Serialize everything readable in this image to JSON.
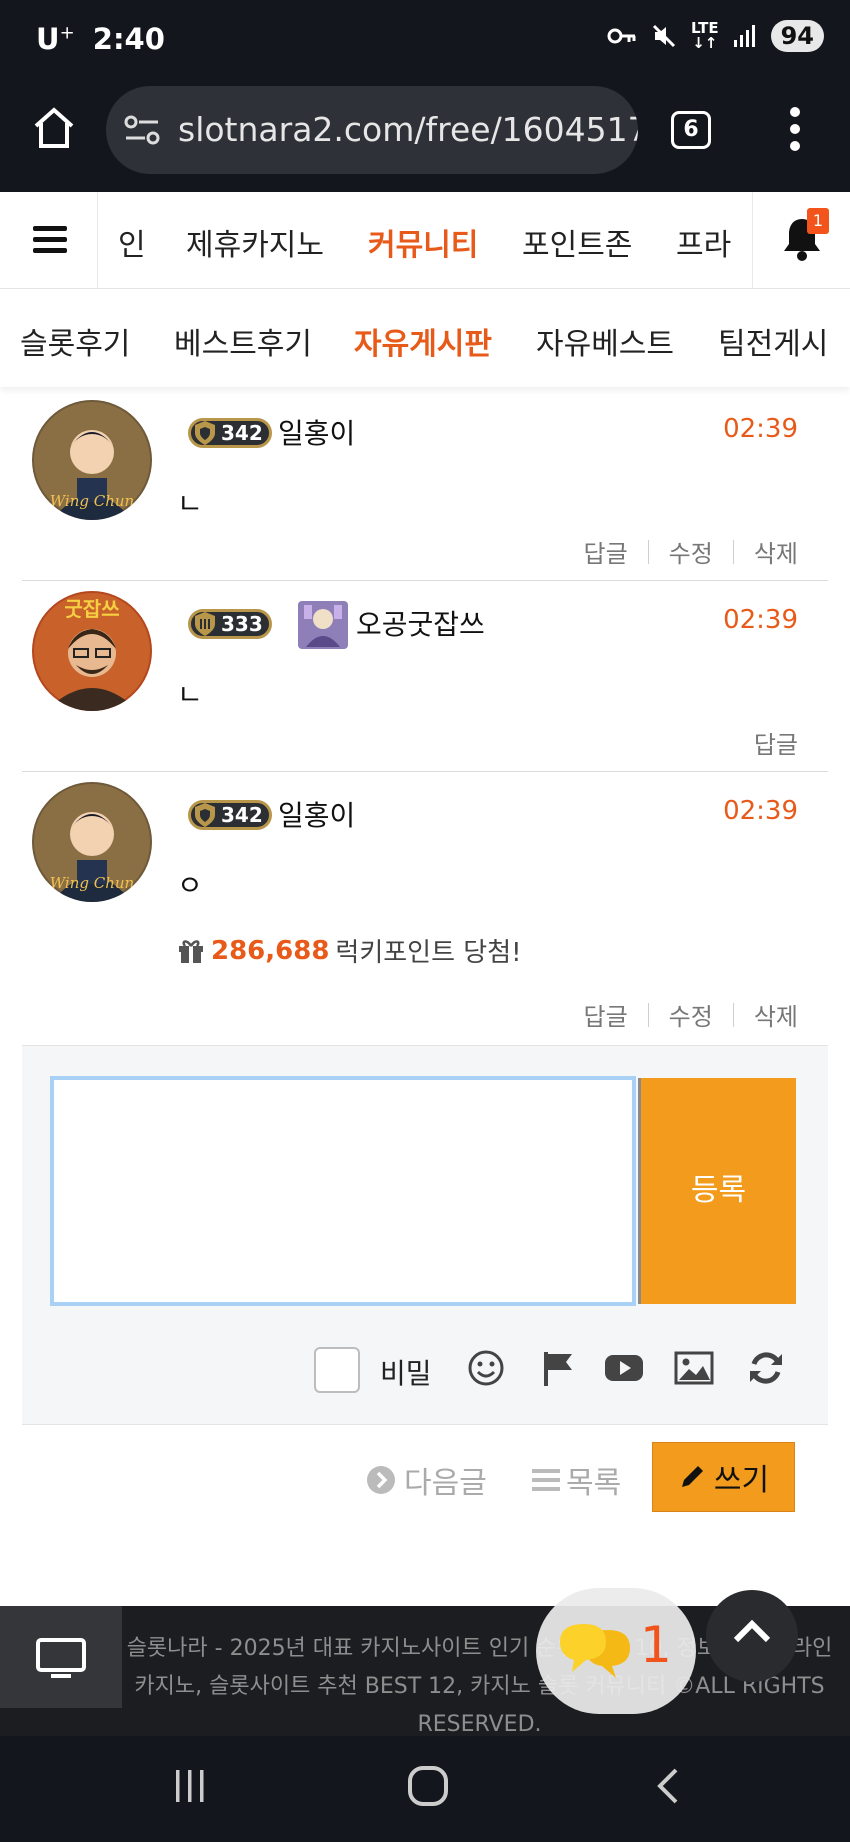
{
  "status_bar": {
    "carrier": "U",
    "carrier_sup": "+",
    "time": "2:40",
    "network": "LTE",
    "battery": "94",
    "icons": [
      "key-icon",
      "mute-icon",
      "signal-icon"
    ]
  },
  "browser": {
    "url": "slotnara2.com/free/1604517",
    "tab_count": "6"
  },
  "site_nav": {
    "items": [
      {
        "label": "인",
        "active": false
      },
      {
        "label": "제휴카지노",
        "active": false
      },
      {
        "label": "커뮤니티",
        "active": true
      },
      {
        "label": "포인트존",
        "active": false
      },
      {
        "label": "프라",
        "active": false
      }
    ],
    "notification_count": "1"
  },
  "sub_nav": {
    "items": [
      {
        "label": "슬롯후기",
        "active": false
      },
      {
        "label": "베스트후기",
        "active": false
      },
      {
        "label": "자유게시판",
        "active": true
      },
      {
        "label": "자유베스트",
        "active": false
      },
      {
        "label": "팀전게시",
        "active": false
      }
    ]
  },
  "comments": [
    {
      "level": "342",
      "username": "일홍이",
      "time": "02:39",
      "body": "ㄴ",
      "actions": [
        "답글",
        "수정",
        "삭제"
      ],
      "avatar_text": "Wing Chun"
    },
    {
      "level": "333",
      "username": "오공굿잡쓰",
      "time": "02:39",
      "body": "ㄴ",
      "actions": [
        "답글"
      ],
      "avatar_text": "굿잡쓰"
    },
    {
      "level": "342",
      "username": "일홍이",
      "time": "02:39",
      "body": "ㅇ",
      "lucky_points": "286,688",
      "lucky_text": "럭키포인트 당첨!",
      "actions": [
        "답글",
        "수정",
        "삭제"
      ],
      "avatar_text": "Wing Chun"
    }
  ],
  "comment_form": {
    "submit_label": "등록",
    "secret_label": "비밀",
    "tool_icons": [
      "smile-icon",
      "flag-icon",
      "youtube-icon",
      "image-icon",
      "refresh-icon"
    ]
  },
  "bottom_links": {
    "next_label": "다음글",
    "list_label": "목록",
    "write_label": "쓰기"
  },
  "footer": {
    "text": "슬롯나라 - 2025년 대표 카지노사이트 인기 순위 TOP 10, 정보 제휴 온라인 카지노, 슬롯사이트 추천 BEST 12, 카지노 슬롯 커뮤니티 ©ALL RIGHTS RESERVED.",
    "chat_count": "1"
  },
  "colors": {
    "accent_orange": "#e85a1a",
    "button_orange": "#f29b1d",
    "dark_bg": "#14161d"
  }
}
